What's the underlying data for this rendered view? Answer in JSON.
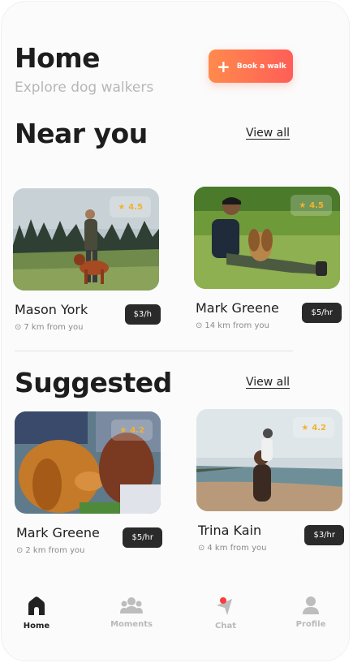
{
  "header": {
    "title": "Home",
    "subtitle": "Explore dog walkers",
    "book_label": "Book a walk"
  },
  "near": {
    "title": "Near you",
    "view_all": "View all",
    "cards": [
      {
        "name": "Mason York",
        "distance": "7 km from you",
        "price": "$3/h",
        "rating": "4.5"
      },
      {
        "name": "Mark Greene",
        "distance": "14 km from you",
        "price": "$5/hr",
        "rating": "4.5"
      }
    ]
  },
  "suggested": {
    "title": "Suggested",
    "view_all": "View all",
    "cards": [
      {
        "name": "Mark Greene",
        "distance": "2 km from you",
        "price": "$5/hr",
        "rating": "4.2"
      },
      {
        "name": "Trina Kain",
        "distance": "4 km from you",
        "price": "$3/hr",
        "rating": "4.2"
      }
    ]
  },
  "nav": {
    "items": [
      {
        "label": "Home",
        "icon": "home-icon",
        "active": true
      },
      {
        "label": "Moments",
        "icon": "group-icon",
        "active": false
      },
      {
        "label": "Chat",
        "icon": "chat-icon",
        "active": false
      },
      {
        "label": "Profile",
        "icon": "profile-icon",
        "active": false
      }
    ]
  },
  "colors": {
    "accent_start": "#ff8a4c",
    "accent_end": "#ff5e57",
    "star": "#f2b230",
    "price_bg": "#2a2a2a",
    "notification_dot": "#ff3b3b"
  }
}
